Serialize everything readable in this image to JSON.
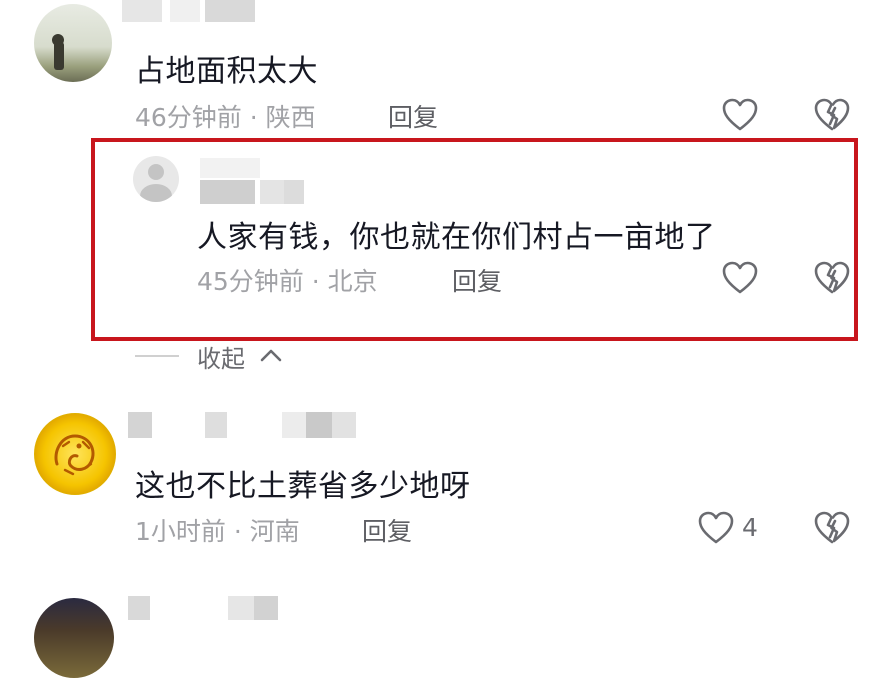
{
  "comments": [
    {
      "text": "占地面积太大",
      "time": "46分钟前",
      "location": "陕西",
      "meta": "46分钟前 · 陕西",
      "reply_label": "回复",
      "like_count": ""
    },
    {
      "text": "人家有钱，你也就在你们村占一亩地了",
      "time": "45分钟前",
      "location": "北京",
      "meta": "45分钟前 · 北京",
      "reply_label": "回复",
      "like_count": ""
    },
    {
      "text": "这也不比土葬省多少地呀",
      "time": "1小时前",
      "location": "河南",
      "meta": "1小时前 · 河南",
      "reply_label": "回复",
      "like_count": "4"
    }
  ],
  "collapse_label": "收起",
  "colors": {
    "highlight_border": "#c8161d",
    "meta_gray": "#a1a2a6",
    "text_dark": "#161823"
  },
  "icons": [
    "heart-outline-icon",
    "broken-heart-icon",
    "chevron-up-icon",
    "default-avatar-icon"
  ]
}
